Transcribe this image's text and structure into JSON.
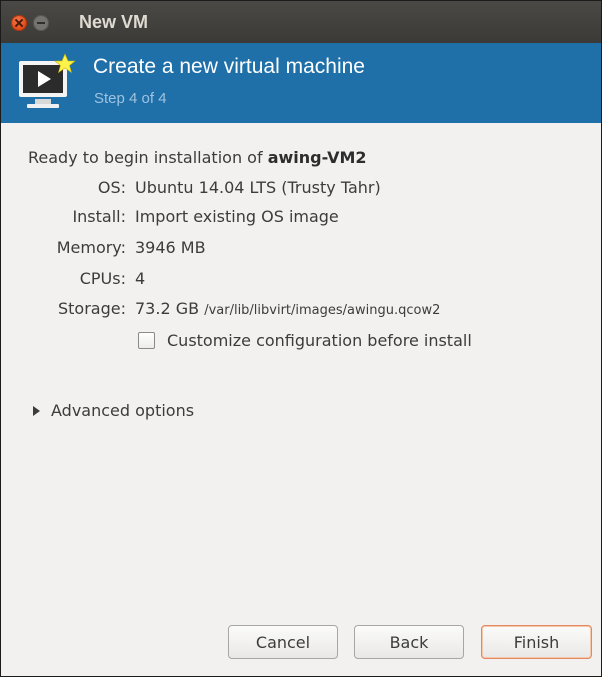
{
  "window": {
    "title": "New VM"
  },
  "banner": {
    "title": "Create a new virtual machine",
    "step": "Step 4 of 4",
    "icon": "vm-monitor-play-icon",
    "accent_color": "#1f6fa8"
  },
  "summary": {
    "ready_prefix": "Ready to begin installation of",
    "vm_name": "awing-VM2",
    "rows": [
      {
        "label": "OS:",
        "value": "Ubuntu 14.04 LTS (Trusty Tahr)"
      },
      {
        "label": "Install:",
        "value": "Import existing OS image"
      },
      {
        "label": "Memory:",
        "value": "3946 MB"
      },
      {
        "label": "CPUs:",
        "value": "4"
      },
      {
        "label": "Storage:",
        "value": "73.2 GB",
        "path": "/var/lib/libvirt/images/awingu.qcow2"
      }
    ]
  },
  "customize": {
    "label": "Customize configuration before install",
    "checked": false
  },
  "advanced": {
    "label": "Advanced options",
    "expanded": false
  },
  "buttons": {
    "cancel": "Cancel",
    "back": "Back",
    "finish": "Finish"
  }
}
